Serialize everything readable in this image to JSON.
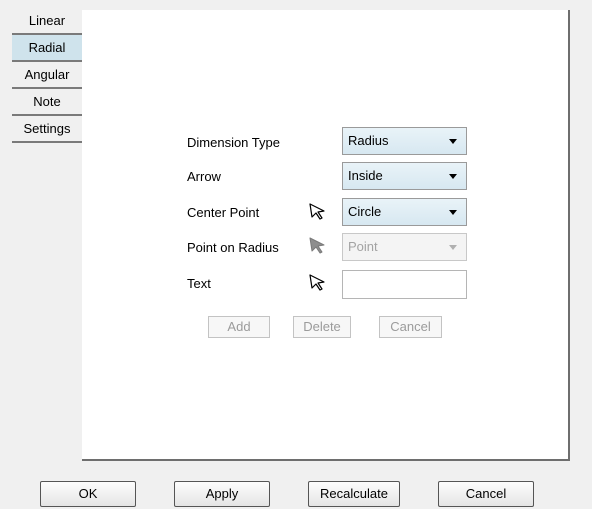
{
  "tabs": [
    "Linear",
    "Radial",
    "Angular",
    "Note",
    "Settings"
  ],
  "active_tab": "Radial",
  "form": {
    "dimension_type": {
      "label": "Dimension Type",
      "value": "Radius"
    },
    "arrow": {
      "label": "Arrow",
      "value": "Inside"
    },
    "center_point": {
      "label": "Center Point",
      "value": "Circle",
      "icon": "pointer-outline-icon"
    },
    "point_on_radius": {
      "label": "Point on Radius",
      "value": "Point",
      "icon": "pointer-filled-icon",
      "disabled": true
    },
    "text": {
      "label": "Text",
      "value": "",
      "icon": "pointer-outline-icon"
    }
  },
  "panel_buttons": {
    "add": "Add",
    "delete": "Delete",
    "cancel": "Cancel"
  },
  "bottom_buttons": {
    "ok": "OK",
    "apply": "Apply",
    "recalculate": "Recalculate",
    "cancel": "Cancel"
  }
}
